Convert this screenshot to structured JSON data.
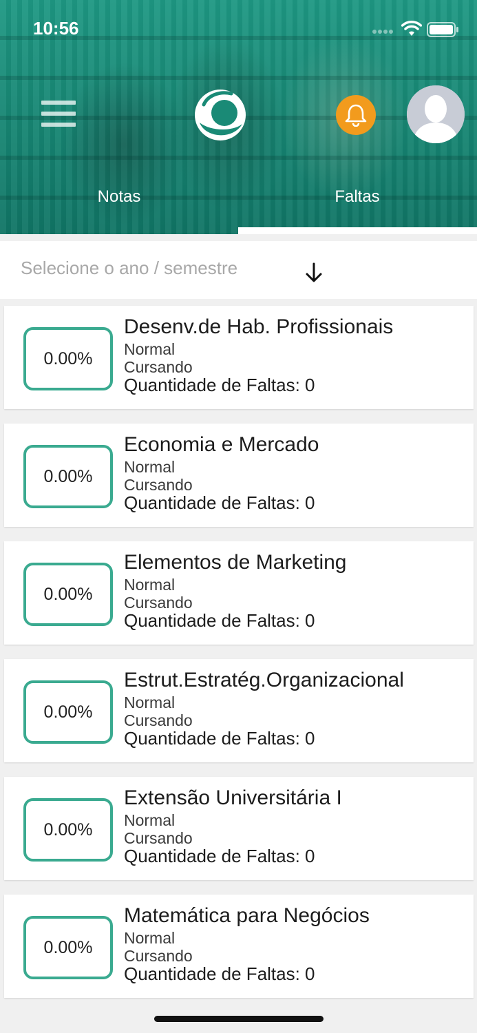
{
  "status_bar": {
    "time": "10:56"
  },
  "tabs": [
    {
      "label": "Notas",
      "active": false
    },
    {
      "label": "Faltas",
      "active": true
    }
  ],
  "icons": {
    "menu": "hamburger-menu-icon",
    "logo": "app-logo",
    "notification": "bell-icon",
    "avatar": "user-avatar",
    "dropdown": "arrow-down-icon"
  },
  "colors": {
    "accent": "#3aaa90",
    "header": "#168371",
    "bell": "#f29b1d"
  },
  "selector": {
    "placeholder": "Selecione o ano / semestre"
  },
  "subjects": [
    {
      "percent": "0.00%",
      "name": "Desenv.de Hab. Profissionais",
      "type": "Normal",
      "status": "Cursando",
      "absences": "Quantidade de Faltas: 0"
    },
    {
      "percent": "0.00%",
      "name": "Economia e Mercado",
      "type": "Normal",
      "status": "Cursando",
      "absences": "Quantidade de Faltas: 0"
    },
    {
      "percent": "0.00%",
      "name": "Elementos de Marketing",
      "type": "Normal",
      "status": "Cursando",
      "absences": "Quantidade de Faltas: 0"
    },
    {
      "percent": "0.00%",
      "name": "Estrut.Estratég.Organizacional",
      "type": "Normal",
      "status": "Cursando",
      "absences": "Quantidade de Faltas: 0"
    },
    {
      "percent": "0.00%",
      "name": "Extensão Universitária I",
      "type": "Normal",
      "status": "Cursando",
      "absences": "Quantidade de Faltas: 0"
    },
    {
      "percent": "0.00%",
      "name": "Matemática para Negócios",
      "type": "Normal",
      "status": "Cursando",
      "absences": "Quantidade de Faltas: 0"
    }
  ]
}
